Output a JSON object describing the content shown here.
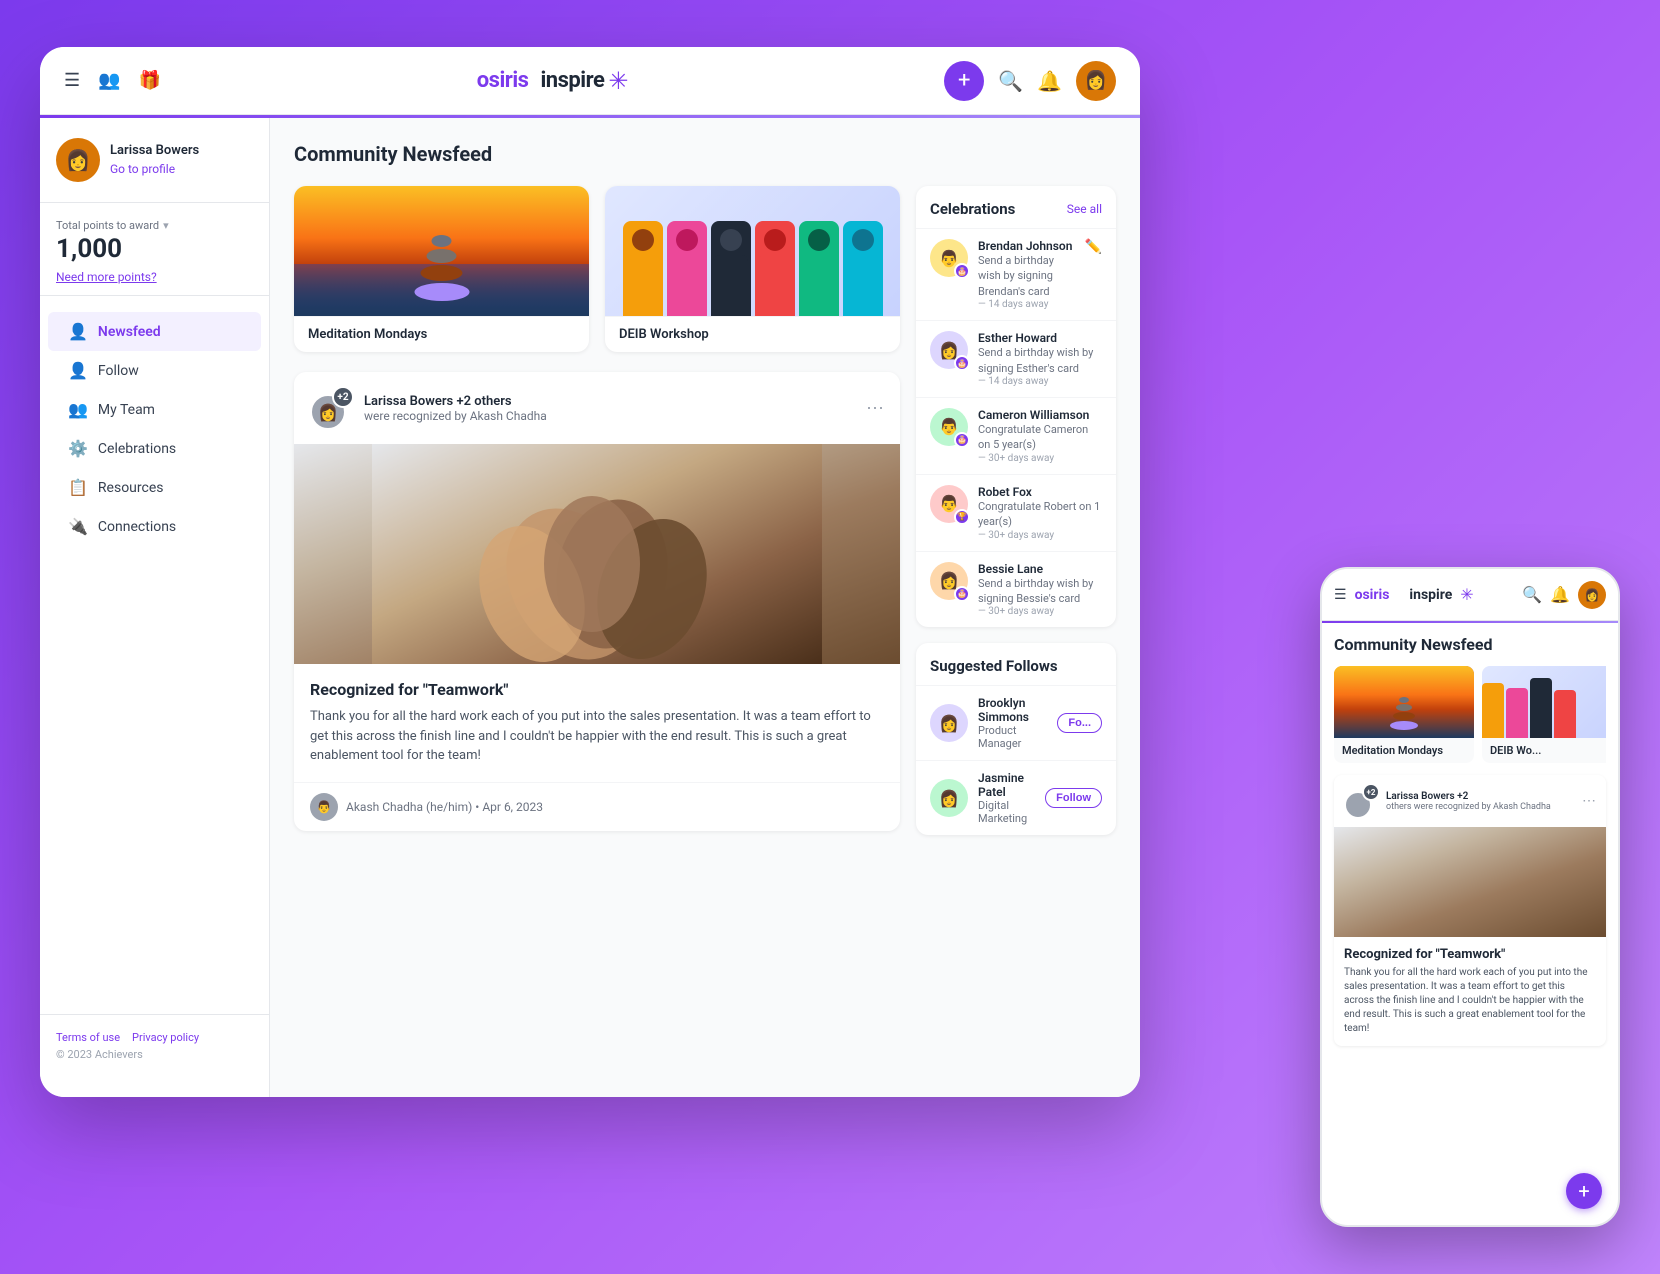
{
  "app": {
    "logo_osiris": "osiris",
    "logo_inspire": "inspire",
    "logo_spark": "✳"
  },
  "header": {
    "menu_icon": "☰",
    "people_icon": "👥",
    "gift_icon": "🎁",
    "plus_label": "+",
    "search_icon": "🔍",
    "bell_icon": "🔔"
  },
  "sidebar": {
    "profile": {
      "name": "Larissa Bowers",
      "link_text": "Go to profile"
    },
    "points": {
      "label": "Total points to award",
      "value": "1,000",
      "need_more_link": "Need more points?"
    },
    "nav": [
      {
        "id": "newsfeed",
        "label": "Newsfeed",
        "icon": "👤",
        "active": true
      },
      {
        "id": "follow",
        "label": "Follow",
        "icon": "👤"
      },
      {
        "id": "my-team",
        "label": "My Team",
        "icon": "👥"
      },
      {
        "id": "celebrations",
        "label": "Celebrations",
        "icon": "⚙️"
      },
      {
        "id": "resources",
        "label": "Resources",
        "icon": "📋"
      },
      {
        "id": "connections",
        "label": "Connections",
        "icon": "🔌"
      }
    ],
    "footer": {
      "terms": "Terms of use",
      "privacy": "Privacy policy",
      "copyright": "© 2023 Achievers"
    }
  },
  "main": {
    "page_title": "Community Newsfeed",
    "community_cards": [
      {
        "id": "meditation",
        "title": "Meditation Mondays"
      },
      {
        "id": "deib",
        "title": "DEIB Workshop"
      }
    ],
    "post": {
      "author": "Larissa Bowers +2 others",
      "action": "were recognized by Akash Chadha",
      "count_badge": "+2",
      "recognition_title": "Recognized for \"Teamwork\"",
      "recognition_text": "Thank you for all the hard work each of you put into the sales presentation. It was a team effort to get this across the finish line and I couldn't be happier with the end result. This is such a great enablement tool for the team!",
      "poster_name": "Akash Chadha (he/him)",
      "post_date": "Apr 6, 2023"
    }
  },
  "celebrations": {
    "title": "Celebrations",
    "see_all_label": "See all",
    "items": [
      {
        "name": "Brendan Johnson",
        "action": "Send a birthday wish by signing Brendan's card",
        "time": "— 14 days away"
      },
      {
        "name": "Esther Howard",
        "action": "Send a birthday wish by signing Esther's card",
        "time": "— 14 days away"
      },
      {
        "name": "Cameron Williamson",
        "action": "Congratulate Cameron on 5 year(s)",
        "time": "— 30+ days away"
      },
      {
        "name": "Robet Fox",
        "action": "Congratulate Robert on 1 year(s)",
        "time": "— 30+ days away"
      },
      {
        "name": "Bessie Lane",
        "action": "Send a birthday wish by signing Bessie's card",
        "time": "— 30+ days away"
      }
    ],
    "edit_icon": "✏️"
  },
  "suggested_follows": {
    "title": "Suggested Follows",
    "items": [
      {
        "name": "Brooklyn Simmons",
        "role": "Product Manager",
        "follow_label": "Fo..."
      },
      {
        "name": "Jasmine Patel",
        "role": "Digital Marketing",
        "follow_label": "Follow"
      }
    ]
  },
  "phone": {
    "title": "Community Newsfeed",
    "meditation_card_title": "Meditation Mondays",
    "deib_card_title": "DEIB Wo...",
    "post_author": "Larissa Bowers +2",
    "post_action": "others were recognized by Akash Chadha",
    "post_recognition_title": "Recognized for \"Teamwork\"",
    "post_text": "Thank you for all the hard work each of you put into the sales presentation. It was a team effort to get this across the finish line and I couldn't be happier with the end result. This is such a great enablement tool for the team!"
  },
  "avatar_emojis": {
    "larissa": "👩",
    "brendan": "👨",
    "esther": "👩",
    "cameron": "👨",
    "robet": "👨",
    "bessie": "👩",
    "brooklyn": "👩",
    "jasmine": "👩"
  },
  "colors": {
    "primary": "#7c3aed",
    "secondary": "#a855f7"
  }
}
